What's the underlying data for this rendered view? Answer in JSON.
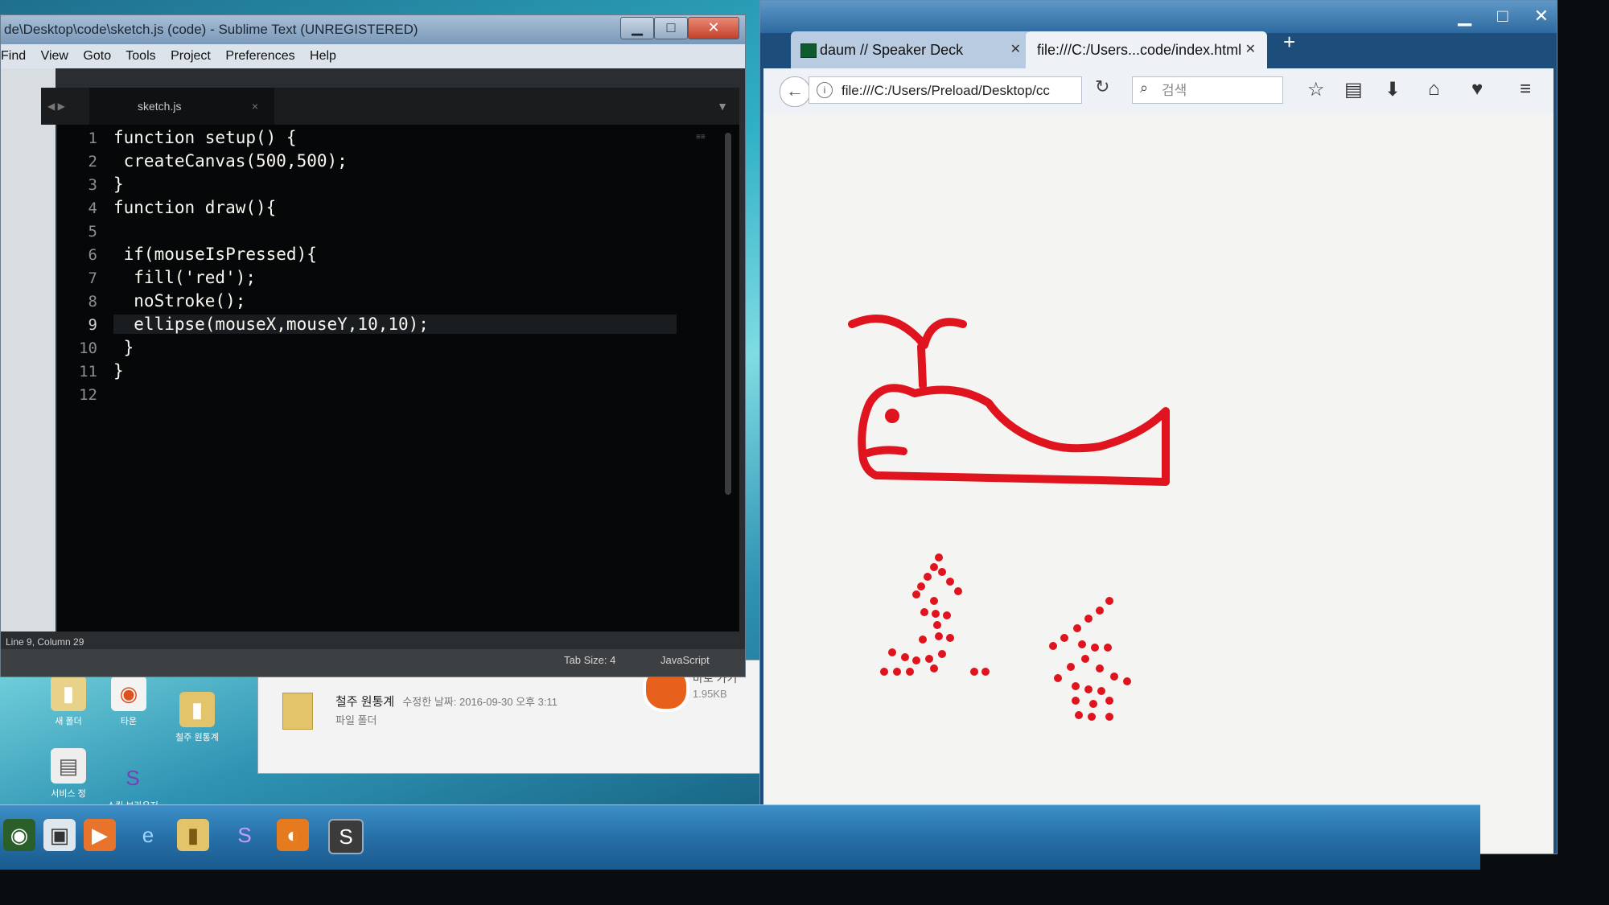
{
  "sublime": {
    "title": "de\\Desktop\\code\\sketch.js (code) - Sublime Text (UNREGISTERED)",
    "menu": [
      "Find",
      "View",
      "Goto",
      "Tools",
      "Project",
      "Preferences",
      "Help"
    ],
    "tab": "sketch.js",
    "code": [
      "function setup() {",
      " createCanvas(500,500);",
      "}",
      "function draw(){",
      "",
      " if(mouseIsPressed){",
      "  fill('red');",
      "  noStroke();",
      "  ellipse(mouseX,mouseY,10,10);",
      " }",
      "}",
      ""
    ],
    "status_position": "Line 9, Column 29",
    "tab_size": "Tab Size: 4",
    "syntax": "JavaScript"
  },
  "firefox": {
    "tabs": [
      {
        "label": "daum // Speaker Deck",
        "active": false
      },
      {
        "label": "file:///C:/Users...code/index.html",
        "active": true
      }
    ],
    "url": "file:///C:/Users/Preload/Desktop/cc",
    "search_placeholder": "검색",
    "toolbar_icons": [
      "star-icon",
      "reading-list-icon",
      "download-icon",
      "home-icon",
      "pocket-icon",
      "menu-icon"
    ]
  },
  "explorer": {
    "file_name": "철주 원통계",
    "modified": "수정한 날짜: 2016-09-30 오후 3:11",
    "file_type": "파일 폴더",
    "shortcut_label": "바로 가기",
    "shortcut_size": "1.95KB"
  },
  "desktop": {
    "icons": [
      "새 폴더",
      "타운",
      "철주 원통계",
      "서비스 정",
      "스킹 브라우저"
    ]
  },
  "colors": {
    "ink": "#e0141e",
    "editor_bg": "#060708",
    "canvas_bg": "#f4f4f2"
  }
}
